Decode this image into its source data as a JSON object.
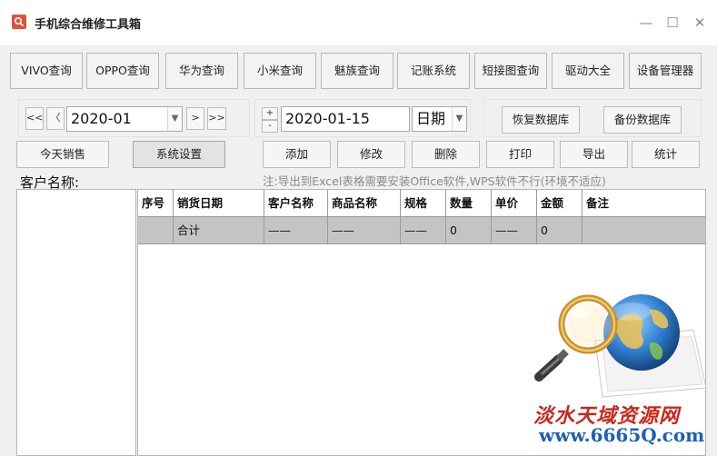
{
  "window": {
    "title": "手机综合维修工具箱",
    "controls": {
      "minimize": "—",
      "maximize": "☐",
      "close": "✕"
    }
  },
  "toolbar": [
    "VIVO查询",
    "OPPO查询",
    "华为查询",
    "小米查询",
    "魅族查询",
    "记账系统",
    "短接图查询",
    "驱动大全",
    "设备管理器"
  ],
  "month_nav": {
    "first": "<<",
    "prev": "〈",
    "value": "2020-01",
    "next": ">",
    "last": ">>"
  },
  "day_nav": {
    "up": "+",
    "down": "-",
    "value": "2020-01-15",
    "unit": "日期"
  },
  "db_buttons": {
    "restore": "恢复数据库",
    "backup": "备份数据库"
  },
  "action_buttons": {
    "today_sales": "今天销售",
    "settings": "系统设置",
    "add": "添加",
    "edit": "修改",
    "delete": "删除",
    "print": "打印",
    "export": "导出",
    "stats": "统计"
  },
  "note": "注:导出到Excel表格需要安装Office软件,WPS软件不行(环境不适应)",
  "customer_label": "客户名称:",
  "table": {
    "columns": [
      "序号",
      "销货日期",
      "客户名称",
      "商品名称",
      "规格",
      "数量",
      "单价",
      "金额",
      "备注"
    ],
    "summary": [
      "",
      "合计",
      "——",
      "——",
      "——",
      "0",
      "——",
      "0",
      ""
    ]
  },
  "watermark": {
    "text": "淡水天域资源网",
    "url": "www.6665Q.com"
  }
}
